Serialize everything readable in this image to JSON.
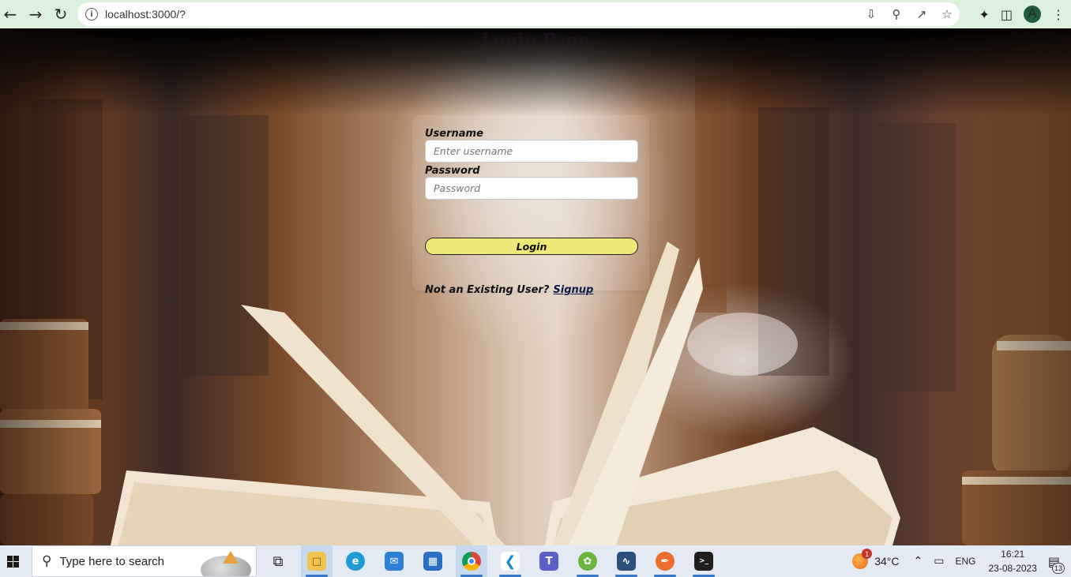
{
  "browser": {
    "url": "localhost:3000/?",
    "profile_initial": "A"
  },
  "page": {
    "faint_title": "Login Page"
  },
  "login_form": {
    "username_label": "Username",
    "username_placeholder": "Enter username",
    "password_label": "Password",
    "password_placeholder": "Password",
    "login_button": "Login",
    "signup_prompt": "Not an Existing User?",
    "signup_link": "Signup"
  },
  "colors": {
    "login_button_bg": "#ece979",
    "browser_bar_bg": "#dbf1dd",
    "taskbar_bg": "#e3eaf4"
  },
  "taskbar": {
    "search_placeholder": "Type here to search",
    "apps": [
      "task-view",
      "file-explorer",
      "edge",
      "mail",
      "microsoft-store",
      "chrome",
      "vs-code",
      "teams",
      "spring-tool-suite",
      "mysql-workbench",
      "postman",
      "terminal"
    ],
    "weather_temp": "34°C",
    "weather_badge": "1",
    "language": "ENG",
    "time": "16:21",
    "date": "23-08-2023",
    "notification_count": "13"
  }
}
